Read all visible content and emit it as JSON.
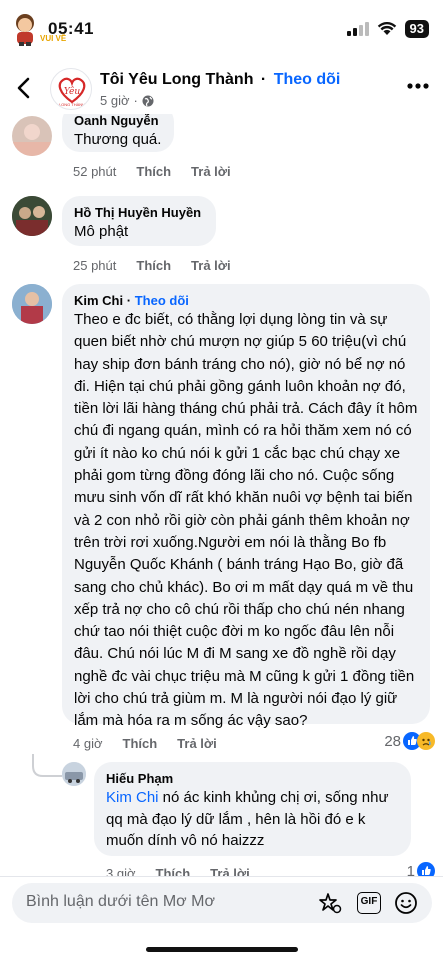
{
  "status_bar": {
    "time": "05:41",
    "sticker_caption": "VUI VỀ",
    "battery": "93"
  },
  "header": {
    "page_name": "Tôi Yêu Long Thành",
    "separator": "·",
    "follow": "Theo dõi",
    "post_time": "5 giờ",
    "avatar_text": "Yêu",
    "avatar_subtext": "LONG THÀNH"
  },
  "comments": [
    {
      "author": "Oanh Nguyễn",
      "text": "Thương quá.",
      "time": "52 phút",
      "like": "Thích",
      "reply": "Trả lời"
    },
    {
      "author": "Hồ Thị Huyền Huyền",
      "text": "Mô phật",
      "time": "25 phút",
      "like": "Thích",
      "reply": "Trả lời"
    },
    {
      "author": "Kim Chi",
      "separator": "·",
      "follow": "Theo dõi",
      "text": "Theo e đc biết, có thằng lợi dụng lòng tin và sự quen biết  nhờ chú mượn nợ giúp 5 60 triệu(vì chú hay ship đơn bánh tráng cho nó), giờ nó bể nợ nó đi. Hiện tại chú phải gồng gánh luôn khoản nợ đó, tiền lời lãi hàng tháng chú phải trả. Cách đây ít hôm chú đi ngang quán, mình có ra hỏi thăm xem nó có gửi ít nào ko chú nói k gửi 1 cắc bạc chú chạy xe phải gom từng đồng đóng lãi cho nó. Cuộc sống mưu sinh vốn dĩ rất khó khăn nuôi vợ bệnh tai biến và 2 con nhỏ rồi giờ còn phải gánh thêm khoản nợ trên trời rơi xuống.Người em nói là thằng Bo fb Nguyễn Quốc Khánh ( bánh tráng Hạo Bo, giờ đã sang cho chủ khác). Bo ơi m mất dạy quá m về thu xếp trả nợ cho cô chú rồi thấp cho chú nén nhang chứ tao nói thiệt cuộc đời m ko ngốc đâu lên nỗi đâu. Chú nói lúc M đi M sang xe đồ nghề rồi dạy nghề đc vài chục triệu mà M cũng k gửi 1 đồng tiền lời cho chú trả giùm m. M là người nói đạo lý giữ lắm mà hóa ra m sống ác vậy sao?",
      "time": "4 giờ",
      "like": "Thích",
      "reply": "Trả lời",
      "reaction_count": "28"
    },
    {
      "author": "Hiếu Phạm",
      "mention": "Kim Chi",
      "text": " nó ác kinh khủng chị ơi, sống như qq mà đạo lý dữ lắm , hên là hồi đó e k muốn dính vô nó haizzz",
      "time": "3 giờ",
      "like": "Thích",
      "reply": "Trả lời",
      "reaction_count": "1"
    }
  ],
  "composer": {
    "placeholder": "Bình luận dưới tên Mơ Mơ",
    "gif": "GIF"
  },
  "colors": {
    "accent": "#0866ff",
    "bubble": "#f0f2f5",
    "muted": "#65676b"
  }
}
